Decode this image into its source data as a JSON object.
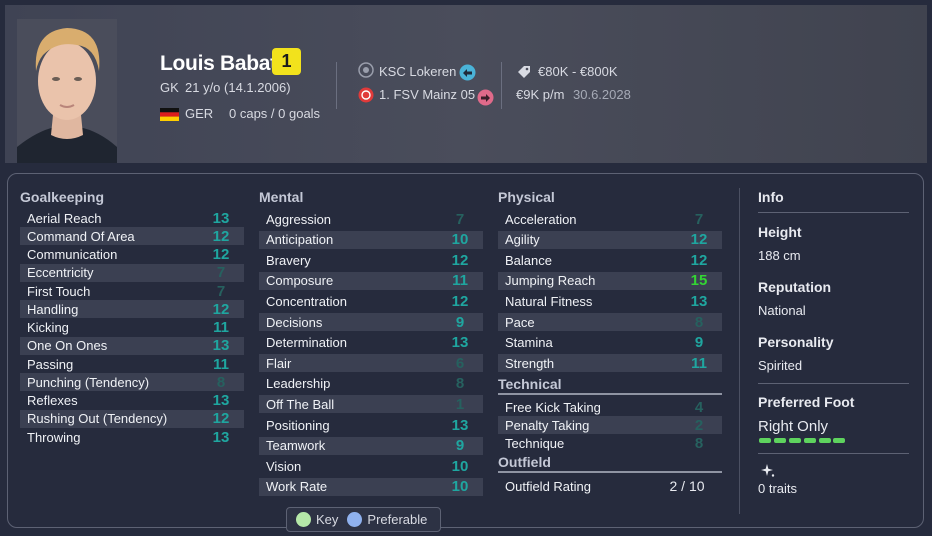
{
  "player": {
    "name": "Louis Babatz",
    "number": "1",
    "position": "GK",
    "age_dob": "21 y/o (14.1.2006)",
    "nationality": "GER",
    "caps": "0 caps / 0 goals"
  },
  "clubs": {
    "current": "KSC Lokeren",
    "parent": "1. FSV Mainz 05"
  },
  "contract": {
    "value": "€80K - €800K",
    "wage": "€9K p/m",
    "expiry": "30.6.2028"
  },
  "goalkeeping": {
    "title": "Goalkeeping",
    "rows": [
      {
        "label": "Aerial Reach",
        "value": "13"
      },
      {
        "label": "Command Of Area",
        "value": "12"
      },
      {
        "label": "Communication",
        "value": "12"
      },
      {
        "label": "Eccentricity",
        "value": "7"
      },
      {
        "label": "First Touch",
        "value": "7"
      },
      {
        "label": "Handling",
        "value": "12"
      },
      {
        "label": "Kicking",
        "value": "11"
      },
      {
        "label": "One On Ones",
        "value": "13"
      },
      {
        "label": "Passing",
        "value": "11"
      },
      {
        "label": "Punching (Tendency)",
        "value": "8"
      },
      {
        "label": "Reflexes",
        "value": "13"
      },
      {
        "label": "Rushing Out (Tendency)",
        "value": "12"
      },
      {
        "label": "Throwing",
        "value": "13"
      }
    ]
  },
  "mental": {
    "title": "Mental",
    "rows": [
      {
        "label": "Aggression",
        "value": "7"
      },
      {
        "label": "Anticipation",
        "value": "10"
      },
      {
        "label": "Bravery",
        "value": "12"
      },
      {
        "label": "Composure",
        "value": "11"
      },
      {
        "label": "Concentration",
        "value": "12"
      },
      {
        "label": "Decisions",
        "value": "9"
      },
      {
        "label": "Determination",
        "value": "13"
      },
      {
        "label": "Flair",
        "value": "6"
      },
      {
        "label": "Leadership",
        "value": "8"
      },
      {
        "label": "Off The Ball",
        "value": "1"
      },
      {
        "label": "Positioning",
        "value": "13"
      },
      {
        "label": "Teamwork",
        "value": "9"
      },
      {
        "label": "Vision",
        "value": "10"
      },
      {
        "label": "Work Rate",
        "value": "10"
      }
    ]
  },
  "physical": {
    "title": "Physical",
    "rows": [
      {
        "label": "Acceleration",
        "value": "7"
      },
      {
        "label": "Agility",
        "value": "12"
      },
      {
        "label": "Balance",
        "value": "12"
      },
      {
        "label": "Jumping Reach",
        "value": "15"
      },
      {
        "label": "Natural Fitness",
        "value": "13"
      },
      {
        "label": "Pace",
        "value": "8"
      },
      {
        "label": "Stamina",
        "value": "9"
      },
      {
        "label": "Strength",
        "value": "11"
      }
    ]
  },
  "technical": {
    "title": "Technical",
    "rows": [
      {
        "label": "Free Kick Taking",
        "value": "4"
      },
      {
        "label": "Penalty Taking",
        "value": "2"
      },
      {
        "label": "Technique",
        "value": "8"
      }
    ]
  },
  "outfield": {
    "title": "Outfield",
    "label": "Outfield Rating",
    "value": "2 / 10"
  },
  "info": {
    "title": "Info",
    "height_label": "Height",
    "height": "188 cm",
    "reputation_label": "Reputation",
    "reputation": "National",
    "personality_label": "Personality",
    "personality": "Spirited",
    "foot_label": "Preferred Foot",
    "foot": "Right Only",
    "traits": "0 traits"
  },
  "legend": {
    "key": "Key",
    "preferable": "Preferable"
  },
  "colors": {
    "attr_high": "#1fa6a0",
    "attr_low": "#26615f",
    "attr_top": "#33d633",
    "badge": "#f2e21c"
  }
}
